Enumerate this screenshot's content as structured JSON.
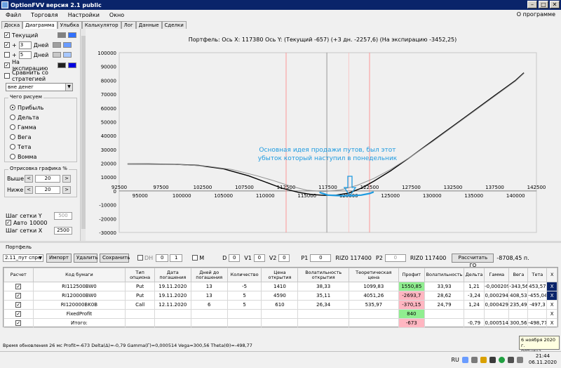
{
  "window": {
    "title": "OptionFVV версия 2.1 public"
  },
  "menu": {
    "items": [
      "Файл",
      "Торговля",
      "Настройки",
      "Окно"
    ],
    "about": "О программе"
  },
  "tabs": [
    "Доска",
    "Диаграмма",
    "Улыбка",
    "Калькулятор",
    "Лог",
    "Данные",
    "Сделки"
  ],
  "left": {
    "current": "Текущий",
    "plus": "+",
    "plus_days_1": "3",
    "plus_days_2": "5",
    "days": "Дней",
    "expiration": "На экспирацию",
    "compare": "Сравнить со стратегией",
    "combo": "вне денег",
    "what_group": "Чего рисуем",
    "options": [
      "Прибыль",
      "Дельта",
      "Гамма",
      "Вега",
      "Тета",
      "Вомма"
    ],
    "draw_group": "Отрисовка графика %",
    "above": "Выше",
    "below": "Ниже",
    "above_val": "20",
    "below_val": "20",
    "grid_y": "Шаг сетки Y",
    "grid_y_val": "500",
    "auto": "Авто",
    "auto_val": "10000",
    "grid_x": "Шаг сетки X",
    "grid_x_val": "2500"
  },
  "chart_data": {
    "type": "line",
    "title": "Портфель:  Ось X: 117380 Ось Y:  (Текущий -657)  (+3 дн. -2257,6)  (На экспирацию -3452,25)",
    "annotation": "Основная идея продажи путов, был этот убыток который наступил в понедельник",
    "xlim": [
      92500,
      142500
    ],
    "ylim": [
      -30000,
      100000
    ],
    "yticks": [
      100000,
      90000,
      80000,
      70000,
      60000,
      50000,
      40000,
      30000,
      20000,
      10000,
      0,
      -10000,
      -20000,
      -30000
    ],
    "xticks_top": [
      92500,
      97500,
      102500,
      107500,
      112500,
      117500,
      122500,
      127500,
      132500,
      137500,
      142500
    ],
    "xticks_bottom": [
      95000,
      100000,
      105000,
      110000,
      115000,
      120000,
      125000,
      130000,
      135000,
      140000
    ],
    "series": [
      {
        "name": "",
        "color": "#000000",
        "x": [
          93500,
          96000,
          99000,
          102000,
          105000,
          108000,
          110000,
          112000,
          114000,
          115500,
          117000,
          118500,
          120000,
          121500,
          123000,
          125000,
          127500,
          130000,
          132500,
          135000,
          137500,
          140000,
          141000
        ],
        "y": [
          19500,
          19500,
          19300,
          18500,
          16000,
          11000,
          6500,
          2000,
          -1000,
          -2500,
          -3200,
          -3000,
          -1500,
          2000,
          7000,
          14500,
          25000,
          36000,
          47000,
          58000,
          69000,
          80000,
          85500
        ]
      },
      {
        "name": "",
        "color": "#909090",
        "x": [
          93500,
          99000,
          103000,
          106000,
          109000,
          111000,
          113000,
          115000,
          117000,
          119000,
          121000,
          123000,
          125000,
          127500,
          130000,
          132500,
          135000,
          137500,
          140000,
          141000
        ],
        "y": [
          19500,
          19300,
          18000,
          15500,
          11000,
          7500,
          3500,
          500,
          -400,
          700,
          4000,
          9000,
          15500,
          25000,
          35500,
          46500,
          57500,
          68500,
          79500,
          85000
        ]
      },
      {
        "name": "",
        "color": "#1e9be0",
        "x": [
          116500,
          117500,
          118500,
          119500,
          120500,
          121500,
          122500,
          123000
        ],
        "y": [
          -1000,
          -3000,
          -3300,
          -3500,
          -3400,
          -3000,
          -1800,
          -700
        ]
      }
    ]
  },
  "portfolio": {
    "title": "Портфель",
    "select": "2.11_пут спре",
    "import": "Импорт",
    "delete": "Удалить",
    "save": "Сохранить",
    "dh": "DH",
    "m": "M",
    "d_label": "D",
    "d_val": "0",
    "v1_label": "V1",
    "v1_val": "0",
    "v2_label": "V2",
    "v2_val": "0",
    "p1_label": "P1",
    "p1_val": "0",
    "riz_a": "RIZ0 117400",
    "p2_label": "P2",
    "p2_val": "0",
    "riz_b": "RIZ0 117400",
    "calc_btn": "Рассчитать ГО",
    "go_val": "-8708,45 п.",
    "columns": [
      "Расчет",
      "Код бумаги",
      "Тип опциона",
      "Дата погашения",
      "Дней до погашения",
      "Количество",
      "Цена открытия",
      "Волатильность открытия",
      "Теоретическая цена",
      "Профит",
      "Волатильность",
      "Дельта",
      "Гамма",
      "Вега",
      "Тета",
      "X"
    ],
    "rows": [
      {
        "code": "RI112500BW0",
        "type": "Put",
        "date": "19.11.2020",
        "days": "13",
        "qty": "-5",
        "price": "1410",
        "vol_open": "38,33",
        "theor": "1099,83",
        "profit": "1550,85",
        "vol": "33,93",
        "delta": "1,21",
        "gamma": "-0,000209",
        "vega": "-343,56",
        "theta": "453,57",
        "x": "X"
      },
      {
        "code": "RI120000BW0",
        "type": "Put",
        "date": "19.11.2020",
        "days": "13",
        "qty": "5",
        "price": "4590",
        "vol_open": "35,11",
        "theor": "4051,26",
        "profit": "-2693,7",
        "vol": "28,62",
        "delta": "-3,24",
        "gamma": "0,000294",
        "vega": "408,53",
        "theta": "-455,04",
        "x": "X"
      },
      {
        "code": "RI120000BK0B",
        "type": "Call",
        "date": "12.11.2020",
        "days": "6",
        "qty": "5",
        "price": "610",
        "vol_open": "26,34",
        "theor": "535,97",
        "profit": "-370,15",
        "vol": "24,79",
        "delta": "1,24",
        "gamma": "0,000429",
        "vega": "235,49",
        "theta": "-497,3",
        "x": "X"
      },
      {
        "code": "FixedProfit",
        "type": "",
        "date": "",
        "days": "",
        "qty": "",
        "price": "",
        "vol_open": "",
        "theor": "",
        "profit": "840",
        "vol": "",
        "delta": "",
        "gamma": "",
        "vega": "",
        "theta": "",
        "x": "X"
      },
      {
        "code": "Итого:",
        "type": "",
        "date": "",
        "days": "",
        "qty": "",
        "price": "",
        "vol_open": "",
        "theor": "",
        "profit": "-673",
        "vol": "",
        "delta": "-0,79",
        "gamma": "0,000514",
        "vega": "300,56",
        "theta": "-498,77",
        "x": "X"
      }
    ]
  },
  "status": {
    "text": "Время обновления 26 мс  Profit=-673 Delta(Δ)=-0,79 Gamma(Γ)=0,000514 Vega=300,56 Theta(Θ)=-498,77"
  },
  "tooltip": {
    "line1": "6 ноября 2020 г.",
    "line2": "пятница"
  },
  "taskbar": {
    "lang": "RU",
    "time": "21:44",
    "date": "06.11.2020"
  }
}
